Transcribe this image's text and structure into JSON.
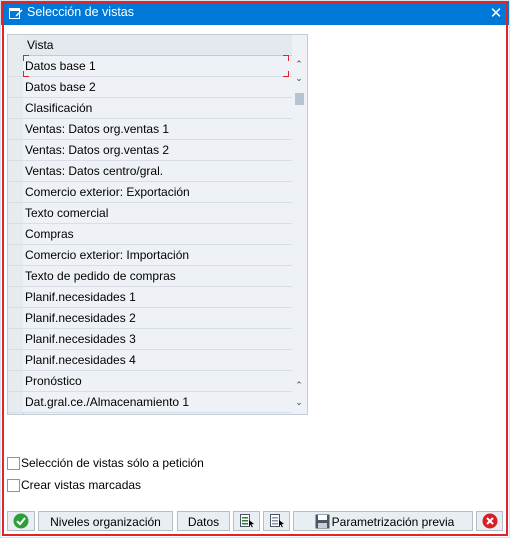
{
  "window": {
    "title": "Selección de vistas",
    "title_icon": "edit-window-icon",
    "close_icon": "close-icon",
    "close_glyph": "✕"
  },
  "table": {
    "column_header": "Vista",
    "rows": [
      "Datos base 1",
      "Datos base 2",
      "Clasificación",
      "Ventas: Datos org.ventas 1",
      "Ventas: Datos org.ventas 2",
      "Ventas: Datos centro/gral.",
      "Comercio exterior: Exportación",
      "Texto comercial",
      "Compras",
      "Comercio exterior: Importación",
      "Texto de pedido de compras",
      "Planif.necesidades 1",
      "Planif.necesidades 2",
      "Planif.necesidades 3",
      "Planif.necesidades 4",
      "Pronóstico",
      "Dat.gral.ce./Almacenamiento 1"
    ],
    "scroll_up_glyph": "⌃",
    "scroll_down_glyph": "⌄"
  },
  "options": {
    "on_request_label": "Selección de vistas sólo a petición",
    "on_request_checked": false,
    "create_marked_label": "Crear vistas marcadas",
    "create_marked_checked": false
  },
  "toolbar": {
    "confirm_icon": "check-icon",
    "org_levels_label": "Niveles organización",
    "data_label": "Datos",
    "select_all_icon": "select-all-icon",
    "deselect_icon": "deselect-icon",
    "default_values_label": "Parametrización previa",
    "default_values_icon": "save-icon",
    "cancel_icon": "cancel-icon"
  },
  "colors": {
    "title_bar": "#0078d7",
    "focus_frame": "#e0242a",
    "confirm": "#2e9e3b",
    "cancel": "#d61f26"
  }
}
